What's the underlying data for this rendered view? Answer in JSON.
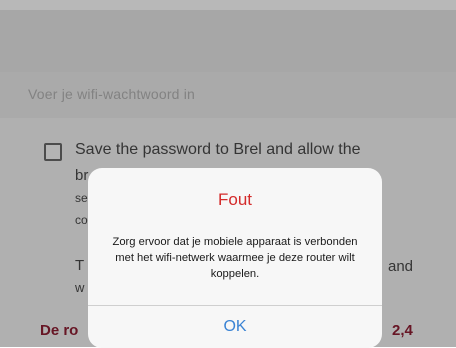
{
  "wifi_form": {
    "password_placeholder": "Voer je  wifi-wachtwoord in",
    "save_password": {
      "line1": "Save the password to Brel and allow the",
      "line2_start": "br",
      "line3_start": "se",
      "line4_start": "co"
    },
    "paragraph2": {
      "line1_start": "T",
      "line1_end": "and",
      "line2_start": "w"
    },
    "router_note": {
      "start": "De ro",
      "end": "2,4"
    }
  },
  "dialog": {
    "title": "Fout",
    "message": "Zorg ervoor dat je mobiele apparaat is verbonden met het wifi-netwerk waarmee je deze router wilt koppelen.",
    "ok_label": "OK"
  },
  "colors": {
    "dialog_title": "#d42a2a",
    "ok_button": "#3a83d4",
    "router_note": "#8f1f34"
  }
}
